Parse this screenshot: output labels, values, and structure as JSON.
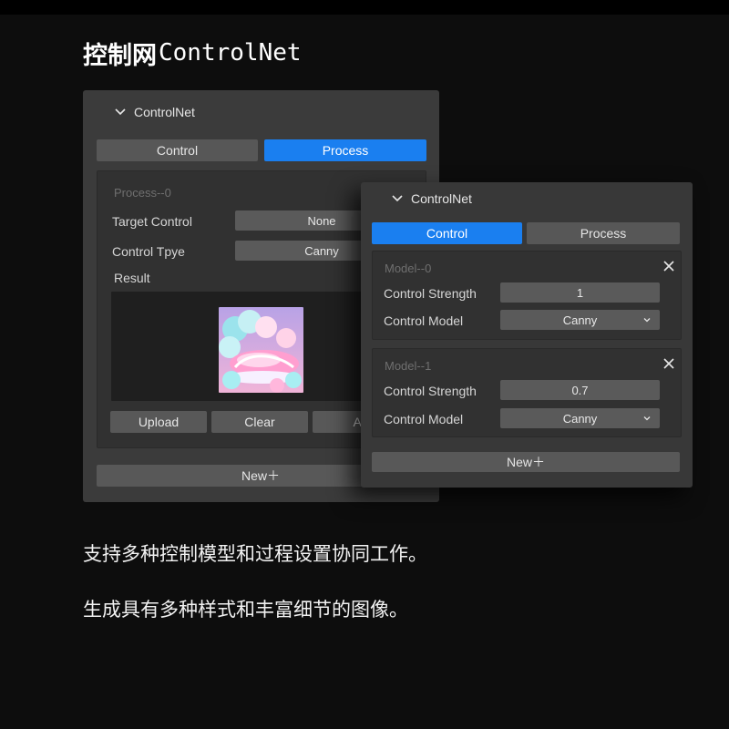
{
  "heading": {
    "cn": "控制网",
    "en": "ControlNet"
  },
  "back_panel": {
    "title": "ControlNet",
    "tabs": [
      {
        "label": "Control",
        "active": false
      },
      {
        "label": "Process",
        "active": true
      }
    ],
    "section_title": "Process--0",
    "target_control": {
      "label": "Target Control",
      "value": "None"
    },
    "control_type": {
      "label": "Control Tpye",
      "value": "Canny"
    },
    "result_label": "Result",
    "buttons": {
      "upload": "Upload",
      "clear": "Clear",
      "apply": "Ap"
    },
    "new_label": "New＋"
  },
  "front_panel": {
    "title": "ControlNet",
    "tabs": [
      {
        "label": "Control",
        "active": true
      },
      {
        "label": "Process",
        "active": false
      }
    ],
    "models": [
      {
        "title": "Model--0",
        "strength": {
          "label": "Control Strength",
          "value": "1"
        },
        "model": {
          "label": "Control Model",
          "value": "Canny"
        }
      },
      {
        "title": "Model--1",
        "strength": {
          "label": "Control Strength",
          "value": "0.7"
        },
        "model": {
          "label": "Control Model",
          "value": "Canny"
        }
      }
    ],
    "new_label": "New＋"
  },
  "captions": [
    "支持多种控制模型和过程设置协同工作。",
    "生成具有多种样式和丰富细节的图像。"
  ],
  "colors": {
    "accent": "#1a7ff0",
    "panel": "#3b3b3b",
    "field": "#5a5a5a",
    "background": "#0d0d0d"
  },
  "icons": {
    "collapse": "chevron-down-icon",
    "dropdown": "chevron-down-icon",
    "close": "close-icon"
  }
}
